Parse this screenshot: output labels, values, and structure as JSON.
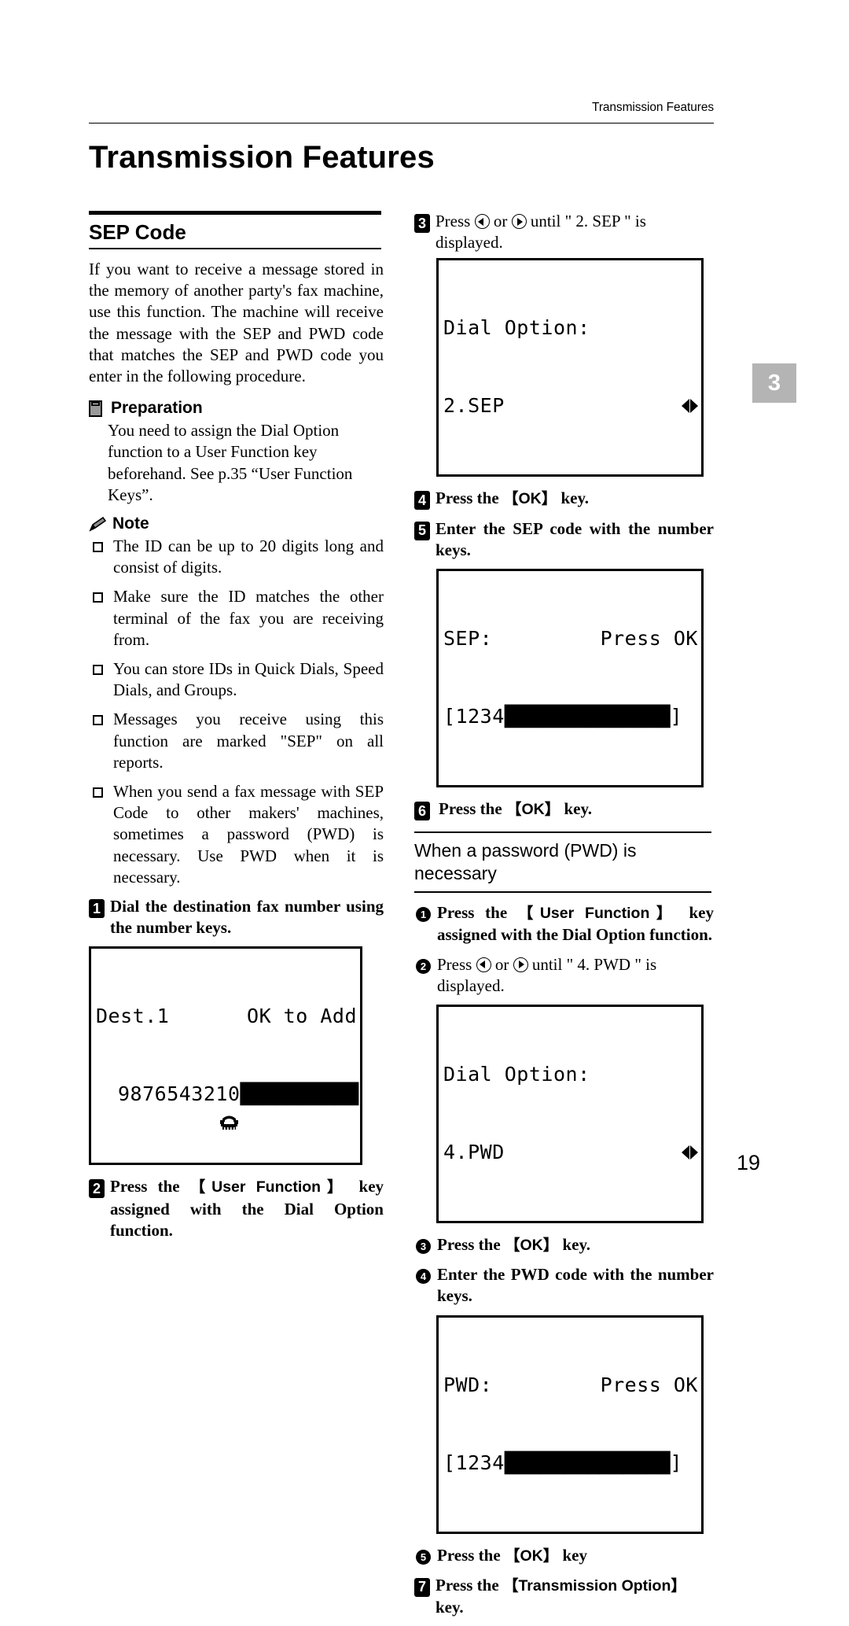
{
  "page": {
    "running_header": "Transmission Features",
    "chapter_title": "Transmission Features",
    "chapter_tab": "3",
    "folio": "19"
  },
  "left_column": {
    "section_title": "SEP Code",
    "intro": "If you want to receive a message stored in the memory of another party's fax machine, use this function. The machine will receive the message with the SEP and PWD code that matches the SEP and PWD code you enter in the following procedure.",
    "preparation": {
      "icon": "book-icon",
      "heading": "Preparation",
      "body": "You need to assign the Dial Option function to a User Function key beforehand. See p.35 “User Function Keys”."
    },
    "note": {
      "icon": "pencil-icon",
      "heading": "Note",
      "items": [
        "The ID can be up to 20 digits long and consist of digits.",
        "Make sure the ID matches the other terminal of the fax you are receiving from.",
        "You can store IDs in Quick Dials, Speed Dials, and Groups.",
        "Messages you receive using this function are marked \"SEP\" on all reports.",
        "When you send a fax message with SEP Code to other makers' machines, sometimes a password (PWD) is necessary. Use PWD when it is necessary."
      ]
    },
    "step1": {
      "num": "1",
      "text": "Dial the destination fax number using the number keys."
    },
    "lcd_dest": {
      "line1_left": "Dest.1",
      "line1_right": "OK to Add",
      "line2_icon": "telephone-icon",
      "line2_number": "9876543210",
      "line2_blocks": "██████████"
    },
    "step2": {
      "num": "2",
      "text_before": "Press the ",
      "keycap": "【User Function】",
      "text_after": " key assigned with the Dial Option function."
    }
  },
  "right_column": {
    "step3": {
      "num": "3",
      "text_before": "Press ",
      "arrow_left": "left-arrow-key-icon",
      "text_mid": " or ",
      "arrow_right": "right-arrow-key-icon",
      "text_after": " until \" 2. SEP \" is displayed."
    },
    "lcd_dialopt_sep": {
      "line1": "Dial Option:",
      "line2": "2.SEP",
      "arrows": "left-right-arrows-icon"
    },
    "step4": {
      "num": "4",
      "text_before": "Press the ",
      "keycap": "【OK】",
      "text_after": " key."
    },
    "step5": {
      "num": "5",
      "text": "Enter the SEP code with the number keys."
    },
    "lcd_sep": {
      "line1_left": "SEP:",
      "line1_right": "Press OK",
      "line2_prefix": "[1234",
      "line2_blocks": "██████████████",
      "line2_suffix": "]"
    },
    "step6": {
      "num": "6",
      "text_before": "Press the ",
      "keycap": "【OK】",
      "text_after": " key."
    },
    "subsection_title": "When a password (PWD) is necessary",
    "sub1": {
      "num": "1",
      "text_before": "Press the ",
      "keycap": "【User Function】",
      "text_after": " key assigned with the Dial Option function."
    },
    "sub2": {
      "num": "2",
      "text_before": "Press ",
      "arrow_left": "left-arrow-key-icon",
      "text_mid": " or ",
      "arrow_right": "right-arrow-key-icon",
      "text_after": " until \" 4. PWD \" is displayed."
    },
    "lcd_dialopt_pwd": {
      "line1": "Dial Option:",
      "line2": "4.PWD",
      "arrows": "left-right-arrows-icon"
    },
    "sub3": {
      "num": "3",
      "text_before": "Press the ",
      "keycap": "【OK】",
      "text_after": " key."
    },
    "sub4": {
      "num": "4",
      "text": "Enter the PWD code with the number keys."
    },
    "lcd_pwd": {
      "line1_left": "PWD:",
      "line1_right": "Press OK",
      "line2_prefix": "[1234",
      "line2_blocks": "██████████████",
      "line2_suffix": "]"
    },
    "sub5": {
      "num": "5",
      "text_before": "Press the ",
      "keycap": "【OK】",
      "text_after": " key"
    },
    "step7": {
      "num": "7",
      "text_before": "Press the ",
      "keycap": "【Transmission Option】",
      "text_after": " key."
    }
  }
}
